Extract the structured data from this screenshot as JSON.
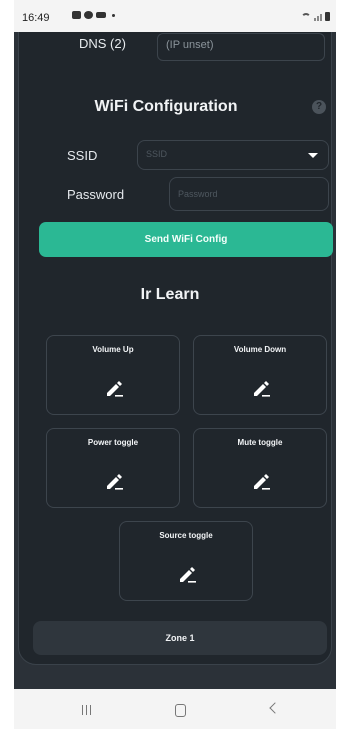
{
  "status_bar": {
    "time": "16:49"
  },
  "dns": {
    "label": "DNS (2)",
    "placeholder": "(IP unset)"
  },
  "wifi": {
    "title": "WiFi Configuration",
    "help": "?",
    "ssid_label": "SSID",
    "ssid_placeholder": "SSID",
    "password_label": "Password",
    "password_placeholder": "Password",
    "send_button": "Send WiFi Config"
  },
  "ir_learn": {
    "title": "Ir Learn",
    "buttons": [
      {
        "label": "Volume Up",
        "icon": "pencil-icon"
      },
      {
        "label": "Volume Down",
        "icon": "pencil-icon"
      },
      {
        "label": "Power toggle",
        "icon": "pencil-icon"
      },
      {
        "label": "Mute toggle",
        "icon": "pencil-icon"
      },
      {
        "label": "Source toggle",
        "icon": "pencil-icon"
      }
    ]
  },
  "zone_button": "Zone 1",
  "colors": {
    "accent": "#2bb894",
    "background": "#20262c",
    "page": "#2b3138"
  }
}
